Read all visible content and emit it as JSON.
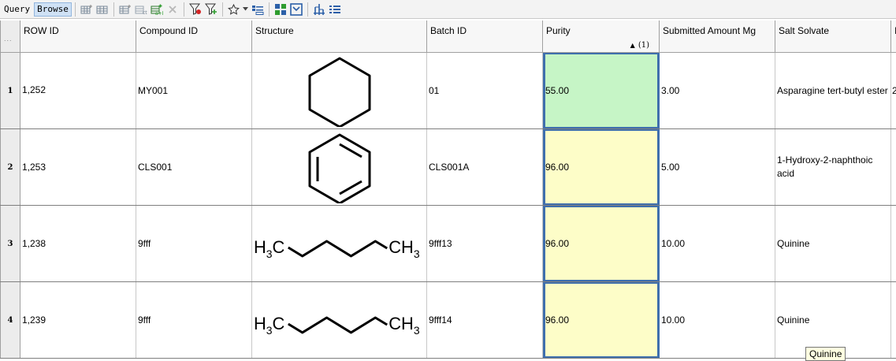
{
  "toolbar": {
    "modes": [
      "Query",
      "Browse"
    ],
    "active_mode": "Browse",
    "icons": [
      "add-column-icon",
      "insert-column-icon",
      "add-row-icon",
      "copy-row-icon",
      "new-record-icon",
      "delete-icon",
      "filter-clear-icon",
      "filter-add-icon",
      "favorite-star-icon",
      "dropdown-arrow-icon",
      "list-view-icon",
      "grid-layout-icon",
      "form-view-icon",
      "hierarchy-icon",
      "column-list-icon"
    ],
    "colors": {
      "accent_blue": "#2b5fa8",
      "delete_red": "#d42424",
      "add_green": "#2e9c2e"
    }
  },
  "grid": {
    "corner": "...",
    "columns": [
      "ROW ID",
      "Compound ID",
      "Structure",
      "Batch ID",
      "Purity",
      "Submitted Amount Mg",
      "Salt Solvate",
      "I"
    ],
    "sort": {
      "column": "Purity",
      "direction": "ascending",
      "order_label": "(1)"
    },
    "rows": [
      {
        "num": "1",
        "row_id": "1,252",
        "compound_id": "MY001",
        "structure": "cyclohexane",
        "batch_id": "01",
        "purity": "55.00",
        "purity_state": "green",
        "submitted_amount": "3.00",
        "salt_solvate": "Asparagine tert-butyl ester",
        "next_col": "2"
      },
      {
        "num": "2",
        "row_id": "1,253",
        "compound_id": "CLS001",
        "structure": "benzene",
        "batch_id": "CLS001A",
        "purity": "96.00",
        "purity_state": "yellow",
        "submitted_amount": "5.00",
        "salt_solvate": "1-Hydroxy-2-naphthoic acid",
        "next_col": ""
      },
      {
        "num": "3",
        "row_id": "1,238",
        "compound_id": "9fff",
        "structure": "pentane",
        "batch_id": "9fff13",
        "purity": "96.00",
        "purity_state": "yellow",
        "submitted_amount": "10.00",
        "salt_solvate": "Quinine",
        "next_col": ""
      },
      {
        "num": "4",
        "row_id": "1,239",
        "compound_id": "9fff",
        "structure": "pentane",
        "batch_id": "9fff14",
        "purity": "96.00",
        "purity_state": "yellow",
        "submitted_amount": "10.00",
        "salt_solvate": "Quinine",
        "next_col": ""
      }
    ],
    "structure_labels": {
      "left_group": "H3C",
      "right_group": "CH3"
    },
    "colors": {
      "purity_green": "#c6f5c6",
      "purity_yellow": "#fdfdc8",
      "selection_border": "#3f6fad"
    }
  },
  "tooltip": {
    "text": "Quinine"
  }
}
